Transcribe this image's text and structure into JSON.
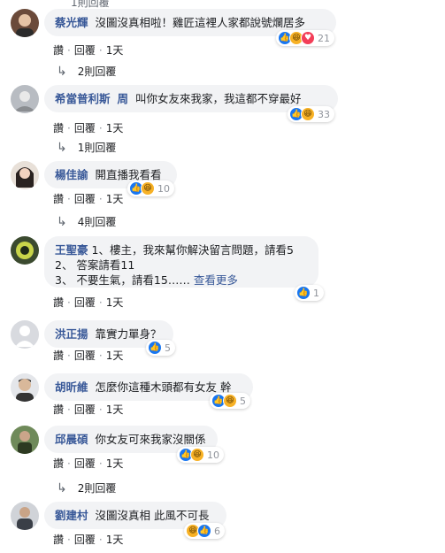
{
  "top_partial": "1則回覆",
  "actions": {
    "read": "讚",
    "reply": "回覆",
    "sep": "·"
  },
  "comments": [
    {
      "author": "蔡光輝",
      "text": "沒圖沒真相啦！雞匠這裡人家都說號爛居多",
      "reaction_count": "21",
      "time": "1天",
      "replies": "2則回覆",
      "reactions": [
        "like",
        "haha",
        "love"
      ]
    },
    {
      "author": "希當普利斯",
      "author_tag": "周",
      "text": "叫你女友來我家，我這都不穿最好",
      "reaction_count": "33",
      "time": "1天",
      "replies": "1則回覆",
      "reactions": [
        "like",
        "haha"
      ]
    },
    {
      "author": "楊佳諭",
      "text": "開直播我看看",
      "reaction_count": "10",
      "time": "1天",
      "replies": "4則回覆",
      "reactions": [
        "like",
        "haha"
      ]
    },
    {
      "author": "王聖豪",
      "text_lines": [
        "1、樓主，我來幫你解決留言問題，請看5",
        "2、 答案請看11",
        "3、 不要生氣，請看15……"
      ],
      "more": "查看更多",
      "reaction_count": "1",
      "time": "1天",
      "reactions": [
        "like"
      ]
    },
    {
      "author": "洪正揚",
      "text": "靠實力單身？",
      "reaction_count": "5",
      "time": "1天",
      "reactions": [
        "like"
      ]
    },
    {
      "author": "胡昕維",
      "text": "怎麼你這種木頭都有女友 幹",
      "reaction_count": "5",
      "time": "1天",
      "reactions": [
        "like",
        "haha"
      ]
    },
    {
      "author": "邱晨碩",
      "text": "你女友可來我家沒關係",
      "reaction_count": "10",
      "time": "1天",
      "replies": "2則回覆",
      "reactions": [
        "like",
        "haha"
      ]
    },
    {
      "author": "劉建村",
      "text": "沒圖沒真相 此風不可長",
      "reaction_count": "6",
      "time": "1天",
      "reactions": [
        "haha",
        "like"
      ]
    }
  ]
}
